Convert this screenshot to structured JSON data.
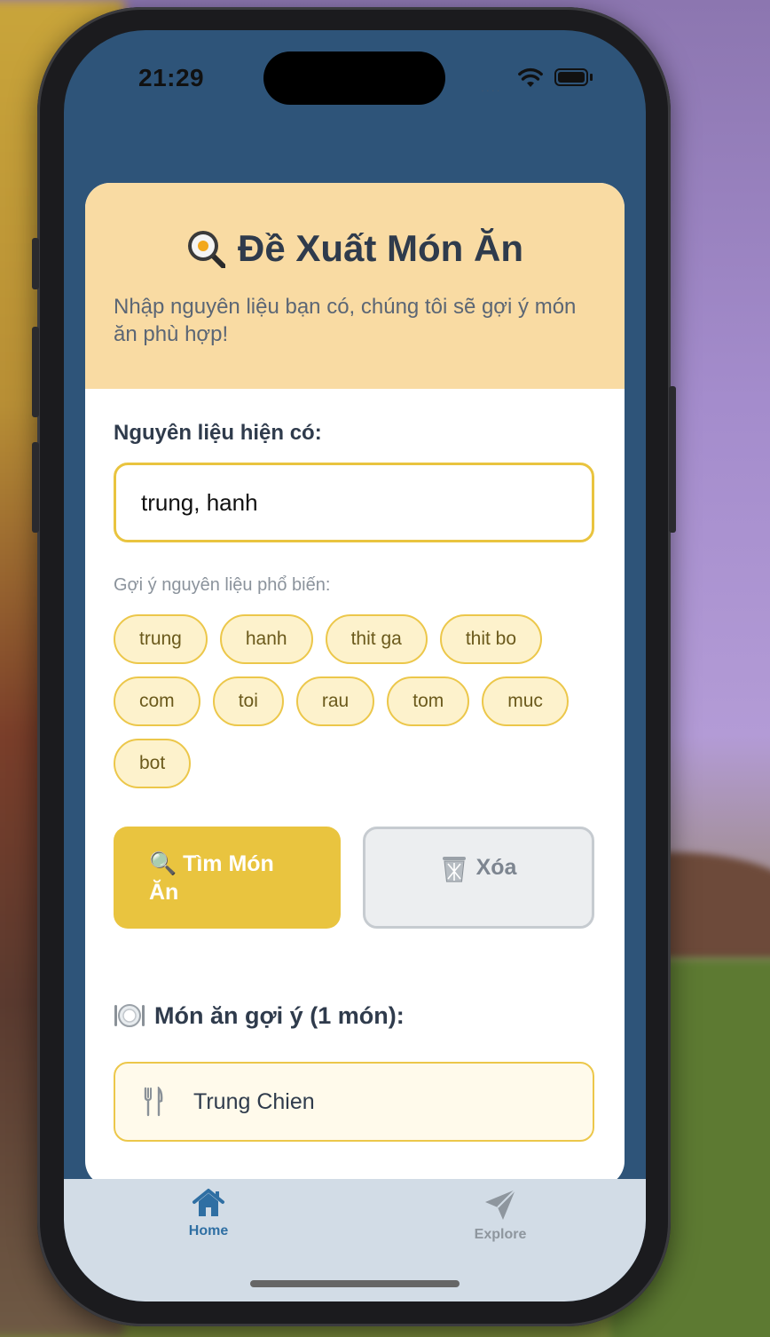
{
  "status_bar": {
    "time": "21:29",
    "signal": "....",
    "wifi_icon": "wifi-icon",
    "battery_icon": "battery-icon"
  },
  "header": {
    "icon": "frying-pan-egg-icon",
    "title": "Đề Xuất Món Ăn",
    "subtitle": "Nhập nguyên liệu bạn có, chúng tôi sẽ gợi ý món ăn phù hợp!"
  },
  "ingredients": {
    "label": "Nguyên liệu hiện có:",
    "value": "trung, hanh"
  },
  "suggestions": {
    "label": "Gợi ý nguyên liệu phổ biến:",
    "chips": [
      "trung",
      "hanh",
      "thit ga",
      "thit bo",
      "com",
      "toi",
      "rau",
      "tom",
      "muc",
      "bot"
    ]
  },
  "actions": {
    "search_label": "🔍 Tìm Món Ăn",
    "clear_icon": "trash-icon",
    "clear_label": "Xóa"
  },
  "results": {
    "icon": "plate-icon",
    "title": "Món ăn gợi ý (1 món):",
    "items": [
      {
        "icon": "fork-knife-icon",
        "name": "Trung Chien"
      }
    ]
  },
  "tabbar": {
    "tabs": [
      {
        "label": "Home",
        "icon": "home-icon",
        "active": true
      },
      {
        "label": "Explore",
        "icon": "paper-plane-icon",
        "active": false
      }
    ]
  },
  "colors": {
    "accent": "#e9c43f",
    "header_bg": "#f9dba3",
    "app_bg": "#2e5479",
    "tab_active": "#2f6fa3"
  }
}
